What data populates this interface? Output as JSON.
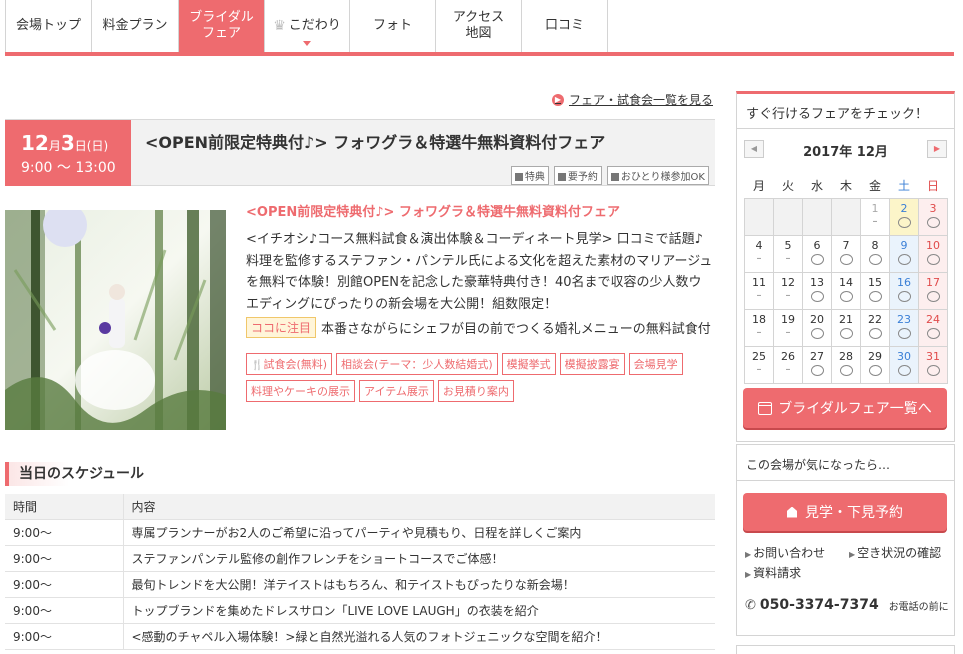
{
  "nav": {
    "tabs": [
      {
        "label": "会場トップ"
      },
      {
        "label": "料金プラン"
      },
      {
        "label": "ブライダル\nフェア",
        "active": true
      },
      {
        "label": "こだわり",
        "icon": "crown-icon"
      },
      {
        "label": "フォト"
      },
      {
        "label": "アクセス\n地図"
      },
      {
        "label": "口コミ"
      }
    ]
  },
  "fair_list_link": "フェア・試食会一覧を見る",
  "fair": {
    "date_day": "12",
    "date_month_unit": "月",
    "date_date": "3",
    "date_date_unit": "日",
    "date_weekday": "(日)",
    "time": "9:00 〜 13:00",
    "title": "<OPEN前限定特典付♪> フォワグラ＆特選牛無料資料付フェア",
    "badges": [
      "特典",
      "要予約",
      "おひとり様参加OK"
    ],
    "subtitle": "<OPEN前限定特典付♪> フォワグラ＆特選牛無料資料付フェア",
    "description": "<イチオシ♪コース無料試食＆演出体験＆コーディネート見学> 口コミで話題♪料理を監修するステファン・パンテル氏による文化を超えた素材のマリアージュを無料で体験！別館OPENを記念した豪華特典付き！40名まで収容の少人数ウエディングにぴったりの新会場を大公開！組数限定！",
    "attention_label": "ココに注目",
    "attention_text": "本番さながらにシェフが目の前でつくる婚礼メニューの無料試食付",
    "tags": [
      "試食会(無料)",
      "相談会(テーマ：少人数結婚式)",
      "模擬挙式",
      "模擬披露宴",
      "会場見学",
      "料理やケーキの展示",
      "アイテム展示",
      "お見積り案内"
    ]
  },
  "schedule": {
    "heading": "当日のスケジュール",
    "col_time": "時間",
    "col_content": "内容",
    "rows": [
      {
        "time": "9:00〜",
        "content": "専属プランナーがお2人のご希望に沿ってパーティや見積もり、日程を詳しくご案内"
      },
      {
        "time": "9:00〜",
        "content": "ステファンパンテル監修の創作フレンチをショートコースでご体感！"
      },
      {
        "time": "9:00〜",
        "content": "最旬トレンドを大公開！洋テイストはもちろん、和テイストもぴったりな新会場！"
      },
      {
        "time": "9:00〜",
        "content": "トップブランドを集めたドレスサロン「LIVE LOVE LAUGH」の衣装を紹介"
      },
      {
        "time": "9:00〜",
        "content": "<感動のチャペル入場体験！>緑と自然光溢れる人気のフォトジェニックな空間を紹介！"
      }
    ]
  },
  "sidebar": {
    "calendar_title": "すぐ行けるフェアをチェック！",
    "month_label": "2017年 12月",
    "weekdays": [
      "月",
      "火",
      "水",
      "木",
      "金",
      "土",
      "日"
    ],
    "weeks": [
      [
        null,
        null,
        null,
        null,
        {
          "d": "1",
          "s": "–",
          "past": true
        },
        {
          "d": "2",
          "s": "o",
          "today": true
        },
        {
          "d": "3",
          "s": "o"
        }
      ],
      [
        {
          "d": "4",
          "s": "–"
        },
        {
          "d": "5",
          "s": "–"
        },
        {
          "d": "6",
          "s": "o"
        },
        {
          "d": "7",
          "s": "o"
        },
        {
          "d": "8",
          "s": "o"
        },
        {
          "d": "9",
          "s": "o"
        },
        {
          "d": "10",
          "s": "o"
        }
      ],
      [
        {
          "d": "11",
          "s": "–"
        },
        {
          "d": "12",
          "s": "–"
        },
        {
          "d": "13",
          "s": "o"
        },
        {
          "d": "14",
          "s": "o"
        },
        {
          "d": "15",
          "s": "o"
        },
        {
          "d": "16",
          "s": "o"
        },
        {
          "d": "17",
          "s": "o"
        }
      ],
      [
        {
          "d": "18",
          "s": "–"
        },
        {
          "d": "19",
          "s": "–"
        },
        {
          "d": "20",
          "s": "o"
        },
        {
          "d": "21",
          "s": "o"
        },
        {
          "d": "22",
          "s": "o"
        },
        {
          "d": "23",
          "s": "o"
        },
        {
          "d": "24",
          "s": "o"
        }
      ],
      [
        {
          "d": "25",
          "s": "–"
        },
        {
          "d": "26",
          "s": "–"
        },
        {
          "d": "27",
          "s": "o"
        },
        {
          "d": "28",
          "s": "o"
        },
        {
          "d": "29",
          "s": "o"
        },
        {
          "d": "30",
          "s": "o"
        },
        {
          "d": "31",
          "s": "o"
        }
      ]
    ],
    "fair_list_button": "ブライダルフェア一覧へ",
    "interest_title": "この会場が気になったら…",
    "visit_button": "見学・下見予約",
    "links": [
      "お問い合わせ",
      "空き状況の確認",
      "資料請求"
    ],
    "phone": "050-3374-7374",
    "phone_note": "お電話の前に"
  },
  "colors": {
    "accent": "#ee6b6f",
    "saturday": "#3a7fd6",
    "sunday": "#e04b4b"
  }
}
